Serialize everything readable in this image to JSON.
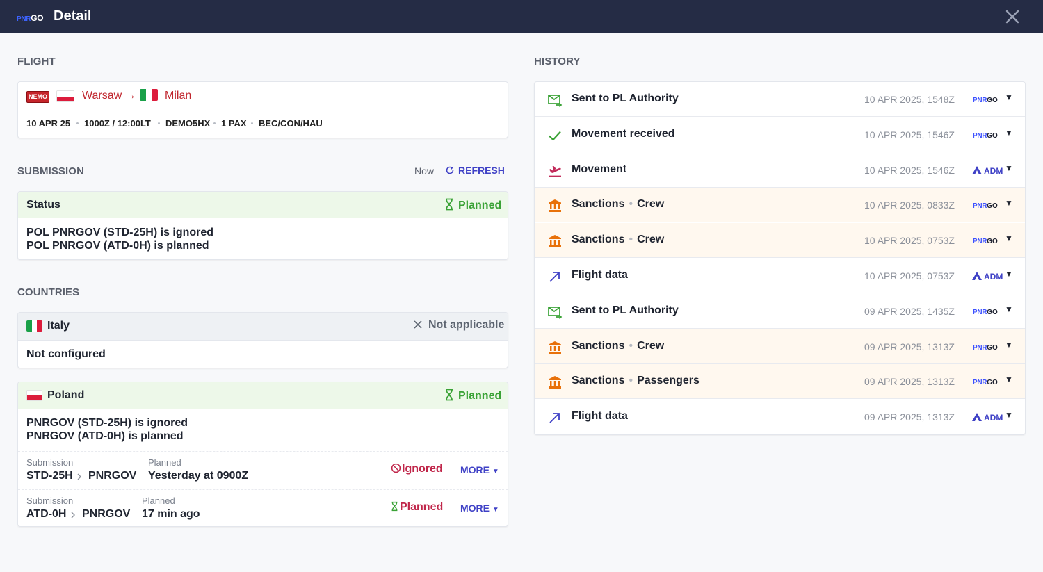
{
  "header": {
    "logo_a": "PNR",
    "logo_b": "GO",
    "title": "Detail"
  },
  "flight": {
    "section": "FLIGHT",
    "badge": "NEMO",
    "origin": "Warsaw",
    "arrow": "→",
    "destination": "Milan",
    "date": "10 APR 25",
    "time": "1000Z / 12:00LT",
    "flight_no": "DEMO5HX",
    "pax": "1 PAX",
    "route": "BEC/CON/HAU"
  },
  "submission": {
    "section": "SUBMISSION",
    "now": "Now",
    "refresh": "REFRESH",
    "status_label": "Status",
    "status_value": "Planned",
    "lines": [
      "POL PNRGOV (STD-25H) is ignored",
      "POL PNRGOV (ATD-0H) is planned"
    ]
  },
  "countries": {
    "section": "COUNTRIES",
    "italy": {
      "name": "Italy",
      "status": "Not applicable",
      "body": "Not configured"
    },
    "poland": {
      "name": "Poland",
      "status": "Planned",
      "lines": [
        "PNRGOV (STD-25H) is ignored",
        "PNRGOV (ATD-0H) is planned"
      ],
      "rows": [
        {
          "sub_label": "Submission",
          "sub_from": "STD-25H",
          "sub_to": "PNRGOV",
          "plan_label": "Planned",
          "plan_value": "Yesterday at 0900Z",
          "status": "Ignored",
          "more": "MORE"
        },
        {
          "sub_label": "Submission",
          "sub_from": "ATD-0H",
          "sub_to": "PNRGOV",
          "plan_label": "Planned",
          "plan_value": "17 min ago",
          "status": "Planned",
          "more": "MORE"
        }
      ]
    }
  },
  "history": {
    "section": "HISTORY",
    "source_adm": "ADM",
    "source_pnr_a": "PNR",
    "source_pnr_b": "GO",
    "items": [
      {
        "icon": "mail-sent-icon",
        "label": "Sent to PL Authority",
        "sub": "",
        "time": "10 APR 2025, 1548Z",
        "source": "pnrgo"
      },
      {
        "icon": "check-icon",
        "label": "Movement received",
        "sub": "",
        "time": "10 APR 2025, 1546Z",
        "source": "pnrgo"
      },
      {
        "icon": "departure-icon",
        "label": "Movement",
        "sub": "",
        "time": "10 APR 2025, 1546Z",
        "source": "adm"
      },
      {
        "icon": "bank-icon",
        "label": "Sanctions",
        "sub": "Crew",
        "time": "10 APR 2025, 0833Z",
        "source": "pnrgo"
      },
      {
        "icon": "bank-icon",
        "label": "Sanctions",
        "sub": "Crew",
        "time": "10 APR 2025, 0753Z",
        "source": "pnrgo"
      },
      {
        "icon": "arrow-up-right-icon",
        "label": "Flight data",
        "sub": "",
        "time": "10 APR 2025, 0753Z",
        "source": "adm"
      },
      {
        "icon": "mail-sent-icon",
        "label": "Sent to PL Authority",
        "sub": "",
        "time": "09 APR 2025, 1435Z",
        "source": "pnrgo"
      },
      {
        "icon": "bank-icon",
        "label": "Sanctions",
        "sub": "Crew",
        "time": "09 APR 2025, 1313Z",
        "source": "pnrgo"
      },
      {
        "icon": "bank-icon",
        "label": "Sanctions",
        "sub": "Passengers",
        "time": "09 APR 2025, 1313Z",
        "source": "pnrgo"
      },
      {
        "icon": "arrow-up-right-icon",
        "label": "Flight data",
        "sub": "",
        "time": "09 APR 2025, 1313Z",
        "source": "adm"
      }
    ]
  },
  "colors": {
    "topbar": "#252c45",
    "accent": "#3f41c6",
    "planned": "#3aa236",
    "ignored": "#c0264a",
    "route": "#c0262e"
  }
}
